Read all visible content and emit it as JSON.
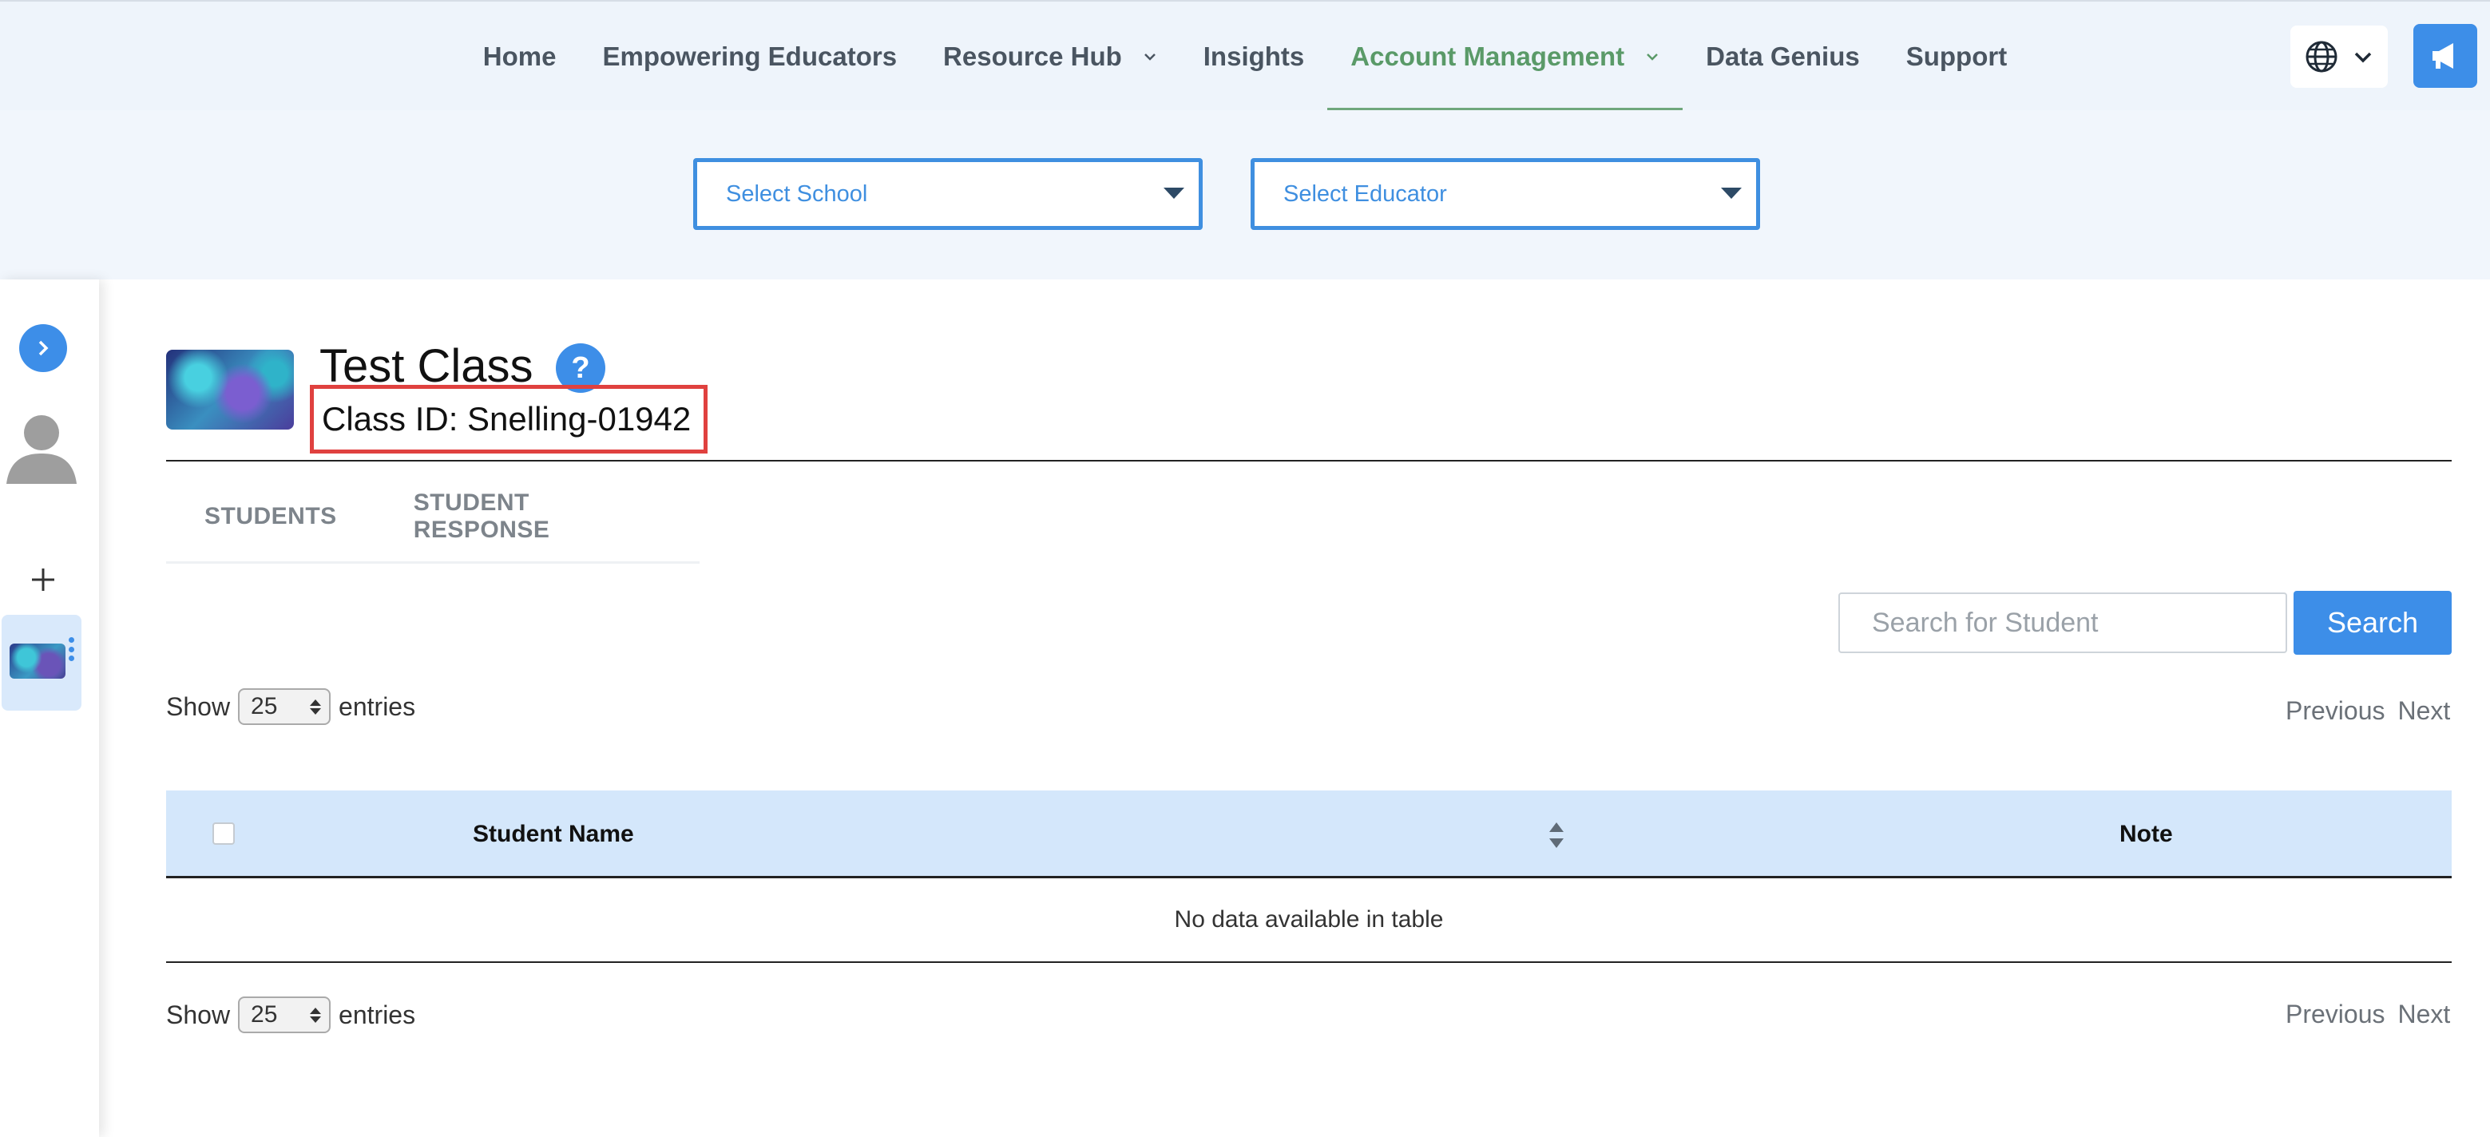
{
  "nav": {
    "items": [
      {
        "label": "Home",
        "has_dropdown": false,
        "active": false
      },
      {
        "label": "Empowering Educators",
        "has_dropdown": false,
        "active": false
      },
      {
        "label": "Resource Hub",
        "has_dropdown": true,
        "active": false
      },
      {
        "label": "Insights",
        "has_dropdown": false,
        "active": false
      },
      {
        "label": "Account Management",
        "has_dropdown": true,
        "active": true
      },
      {
        "label": "Data Genius",
        "has_dropdown": false,
        "active": false
      },
      {
        "label": "Support",
        "has_dropdown": false,
        "active": false
      }
    ],
    "language_icon": "globe-icon",
    "announcement_icon": "megaphone-icon"
  },
  "filters": {
    "school_placeholder": "Select School",
    "educator_placeholder": "Select Educator"
  },
  "class": {
    "title": "Test Class",
    "help_glyph": "?",
    "id_text": "Class ID: Snelling-01942"
  },
  "tabs": [
    "STUDENTS",
    "STUDENT RESPONSE"
  ],
  "search": {
    "placeholder": "Search for Student",
    "button_label": "Search"
  },
  "table": {
    "length_prefix": "Show",
    "length_value": "25",
    "length_suffix": "entries",
    "previous_label": "Previous",
    "next_label": "Next",
    "columns": [
      "Student Name",
      "Note"
    ],
    "empty_message": "No data available in table"
  },
  "colors": {
    "accent": "#3d8ee8",
    "nav_active": "#5a9a68",
    "highlight_box": "#e0413f",
    "table_header_bg": "#d4e7fb"
  }
}
